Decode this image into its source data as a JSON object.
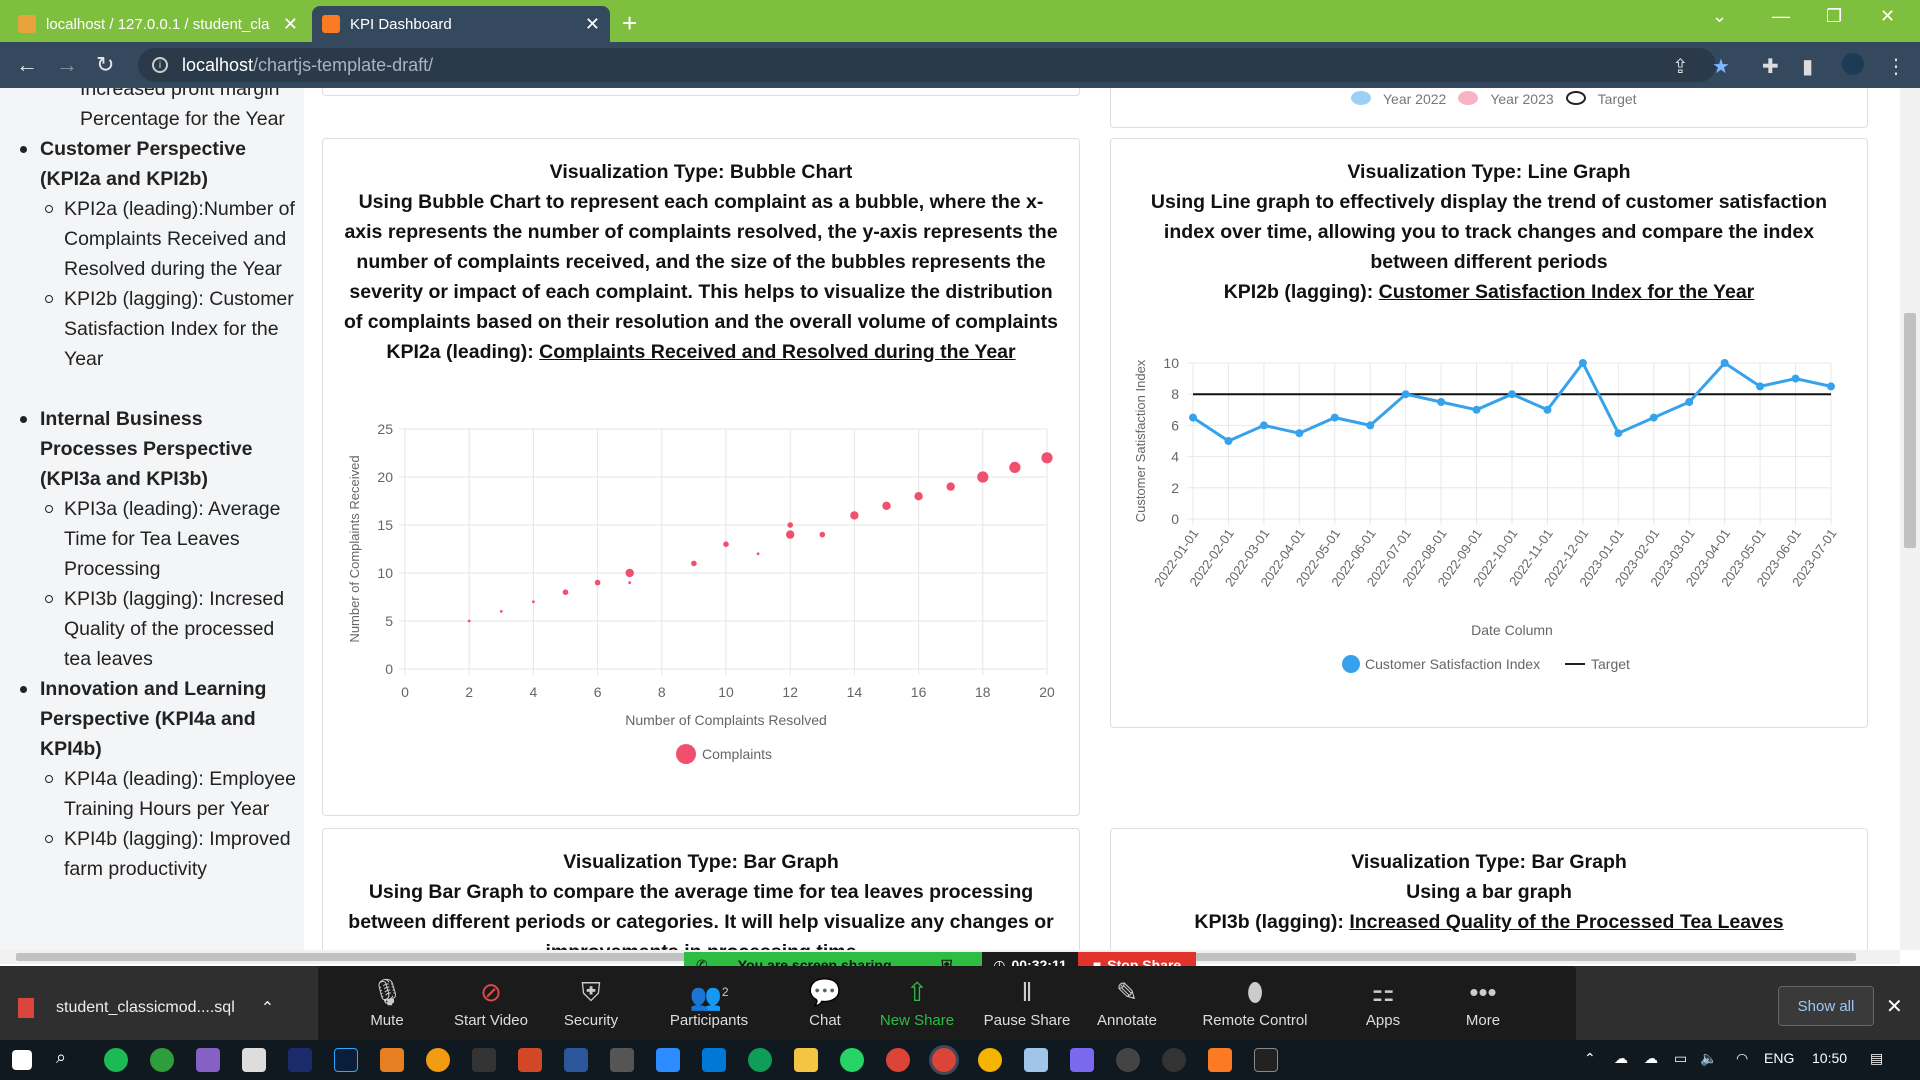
{
  "browser": {
    "tabs": [
      {
        "title": "localhost / 127.0.0.1 / student_cla",
        "icon": "phpmyadmin-icon",
        "active": false
      },
      {
        "title": "KPI Dashboard",
        "icon": "xampp-icon",
        "active": true
      }
    ],
    "url_host": "localhost",
    "url_path": "/chartjs-template-draft/"
  },
  "sidebar": {
    "partial_top": "Increased profit margin",
    "partial_top2": "Percentage for the Year",
    "sections": [
      {
        "title": "Customer Perspective (KPI2a and KPI2b)",
        "items": [
          "KPI2a (leading):Number of Complaints Received and Resolved during the Year",
          "KPI2b (lagging): Customer Satisfaction Index for the Year"
        ]
      },
      {
        "title": "Internal Business Processes Perspective (KPI3a and KPI3b)",
        "items": [
          "KPI3a (leading): Average Time for Tea Leaves Processing",
          "KPI3b (lagging): Incresed Quality of the processed tea leaves"
        ]
      },
      {
        "title": "Innovation and Learning Perspective (KPI4a and KPI4b)",
        "items": [
          "KPI4a (leading): Employee Training Hours per Year",
          "KPI4b (lagging): Improved farm productivity"
        ]
      }
    ]
  },
  "cards": {
    "top_legend": [
      "Year 2022",
      "Year 2023",
      "Target"
    ],
    "bubble": {
      "type_line": "Visualization Type: Bubble Chart",
      "desc": "Using Bubble Chart to represent each complaint as a bubble, where the x-axis represents the number of complaints resolved, the y-axis represents the number of complaints received, and the size of the bubbles represents the severity or impact of each complaint. This helps to visualize the distribution of complaints based on their resolution and the overall volume of complaints",
      "kpi_prefix": "KPI2a (leading): ",
      "kpi_link": "Complaints Received and Resolved during the Year"
    },
    "line": {
      "type_line": "Visualization Type: Line Graph",
      "desc": "Using Line graph to effectively display the trend of customer satisfaction index over time, allowing you to track changes and compare the index between different periods",
      "kpi_prefix": "KPI2b (lagging): ",
      "kpi_link": "Customer Satisfaction Index for the Year"
    },
    "bar1": {
      "type_line": "Visualization Type: Bar Graph",
      "desc": "Using Bar Graph to compare the average time for tea leaves processing between different periods or categories. It will help visualize any changes or improvements in processing time"
    },
    "bar2": {
      "type_line": "Visualization Type: Bar Graph",
      "desc": "Using a bar graph",
      "kpi_prefix": "KPI3b (lagging): ",
      "kpi_link": "Increased Quality of the Processed Tea Leaves"
    }
  },
  "chart_data": [
    {
      "type": "scatter",
      "subtype": "bubble",
      "title": "",
      "xlabel": "Number of Complaints Resolved",
      "ylabel": "Number of Complaints Received",
      "xlim": [
        0,
        20
      ],
      "ylim": [
        0,
        25
      ],
      "xticks": [
        0,
        2,
        4,
        6,
        8,
        10,
        12,
        14,
        16,
        18,
        20
      ],
      "yticks": [
        0,
        5,
        10,
        15,
        20,
        25
      ],
      "grid": true,
      "legend_position": "bottom",
      "color": "#f0506e",
      "series": [
        {
          "name": "Complaints",
          "points": [
            {
              "x": 2,
              "y": 5,
              "r": 1
            },
            {
              "x": 3,
              "y": 6,
              "r": 1
            },
            {
              "x": 4,
              "y": 7,
              "r": 1
            },
            {
              "x": 5,
              "y": 8,
              "r": 2
            },
            {
              "x": 6,
              "y": 9,
              "r": 2
            },
            {
              "x": 7,
              "y": 10,
              "r": 3
            },
            {
              "x": 7,
              "y": 9,
              "r": 1
            },
            {
              "x": 9,
              "y": 11,
              "r": 2
            },
            {
              "x": 10,
              "y": 13,
              "r": 2
            },
            {
              "x": 11,
              "y": 12,
              "r": 1
            },
            {
              "x": 12,
              "y": 15,
              "r": 2
            },
            {
              "x": 12,
              "y": 14,
              "r": 3
            },
            {
              "x": 13,
              "y": 14,
              "r": 2
            },
            {
              "x": 14,
              "y": 16,
              "r": 3
            },
            {
              "x": 15,
              "y": 17,
              "r": 3
            },
            {
              "x": 16,
              "y": 18,
              "r": 3
            },
            {
              "x": 17,
              "y": 19,
              "r": 3
            },
            {
              "x": 18,
              "y": 20,
              "r": 4
            },
            {
              "x": 19,
              "y": 21,
              "r": 4
            },
            {
              "x": 20,
              "y": 22,
              "r": 4
            }
          ]
        }
      ]
    },
    {
      "type": "line",
      "title": "",
      "xlabel": "Date Column",
      "ylabel": "Customer Satisfaction Index",
      "ylim": [
        0,
        10
      ],
      "yticks": [
        0,
        2,
        4,
        6,
        8,
        10
      ],
      "grid": true,
      "legend_position": "bottom",
      "categories": [
        "2022-01-01",
        "2022-02-01",
        "2022-03-01",
        "2022-04-01",
        "2022-05-01",
        "2022-06-01",
        "2022-07-01",
        "2022-08-01",
        "2022-09-01",
        "2022-10-01",
        "2022-11-01",
        "2022-12-01",
        "2023-01-01",
        "2023-02-01",
        "2023-03-01",
        "2023-04-01",
        "2023-05-01",
        "2023-06-01",
        "2023-07-01"
      ],
      "series": [
        {
          "name": "Customer Satisfaction Index",
          "color": "#36a2eb",
          "values": [
            6.5,
            5,
            6,
            5.5,
            6.5,
            6,
            8,
            7.5,
            7,
            8,
            7,
            10,
            5.5,
            6.5,
            7.5,
            10,
            8.5,
            9,
            8.5
          ]
        },
        {
          "name": "Target",
          "color": "#111111",
          "values": [
            8,
            8,
            8,
            8,
            8,
            8,
            8,
            8,
            8,
            8,
            8,
            8,
            8,
            8,
            8,
            8,
            8,
            8,
            8
          ]
        }
      ]
    }
  ],
  "share_bar": {
    "status": "You are screen sharing",
    "timer": "00:32:11",
    "stop": "Stop Share"
  },
  "downloads": {
    "file": "student_classicmod....sql",
    "show_all": "Show all"
  },
  "zoom": {
    "buttons": [
      {
        "label": "Mute",
        "icon": "microphone-icon"
      },
      {
        "label": "Start Video",
        "icon": "video-off-icon"
      },
      {
        "label": "Security",
        "icon": "shield-icon"
      },
      {
        "label": "Participants",
        "icon": "participants-icon",
        "count": "2"
      },
      {
        "label": "Chat",
        "icon": "chat-icon"
      },
      {
        "label": "New Share",
        "icon": "share-arrow-icon"
      },
      {
        "label": "Pause Share",
        "icon": "pause-icon"
      },
      {
        "label": "Annotate",
        "icon": "pen-icon"
      },
      {
        "label": "Remote Control",
        "icon": "mouse-icon"
      },
      {
        "label": "Apps",
        "icon": "apps-icon"
      },
      {
        "label": "More",
        "icon": "more-dots-icon"
      }
    ]
  },
  "taskbar": {
    "lang": "ENG",
    "time": "10:50"
  }
}
